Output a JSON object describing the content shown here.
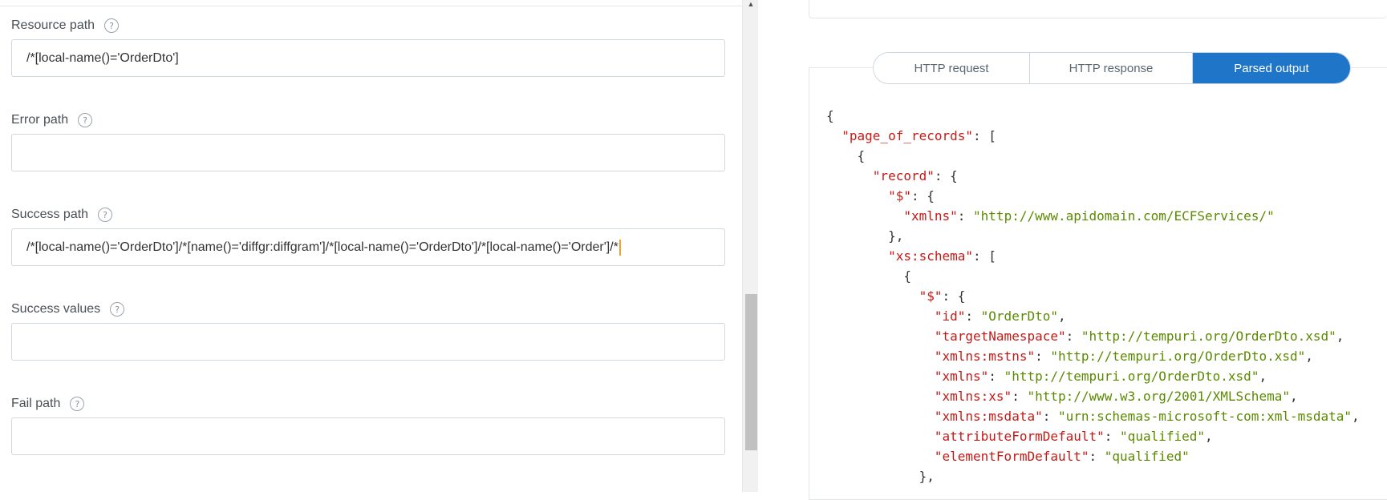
{
  "form": {
    "resource_path": {
      "label": "Resource path",
      "value": "/*[local-name()='OrderDto']"
    },
    "error_path": {
      "label": "Error path",
      "value": ""
    },
    "success_path": {
      "label": "Success path",
      "value": "/*[local-name()='OrderDto']/*[name()='diffgr:diffgram']/*[local-name()='OrderDto']/*[local-name()='Order']/*"
    },
    "success_values": {
      "label": "Success values",
      "value": ""
    },
    "fail_path": {
      "label": "Fail path",
      "value": ""
    },
    "help_glyph": "?"
  },
  "scrollbar": {
    "up_arrow": "▲"
  },
  "output": {
    "tabs": [
      {
        "label": "HTTP request",
        "active": false
      },
      {
        "label": "HTTP response",
        "active": false
      },
      {
        "label": "Parsed output",
        "active": true
      }
    ],
    "json_lines": [
      [
        [
          "p",
          "{"
        ]
      ],
      [
        [
          "p",
          "  "
        ],
        [
          "k",
          "\"page_of_records\""
        ],
        [
          "p",
          ": ["
        ]
      ],
      [
        [
          "p",
          "    {"
        ]
      ],
      [
        [
          "p",
          "      "
        ],
        [
          "k",
          "\"record\""
        ],
        [
          "p",
          ": {"
        ]
      ],
      [
        [
          "p",
          "        "
        ],
        [
          "k",
          "\"$\""
        ],
        [
          "p",
          ": {"
        ]
      ],
      [
        [
          "p",
          "          "
        ],
        [
          "k",
          "\"xmlns\""
        ],
        [
          "p",
          ": "
        ],
        [
          "s",
          "\"http://www.apidomain.com/ECFServices/\""
        ]
      ],
      [
        [
          "p",
          "        },"
        ]
      ],
      [
        [
          "p",
          "        "
        ],
        [
          "k",
          "\"xs:schema\""
        ],
        [
          "p",
          ": ["
        ]
      ],
      [
        [
          "p",
          "          {"
        ]
      ],
      [
        [
          "p",
          "            "
        ],
        [
          "k",
          "\"$\""
        ],
        [
          "p",
          ": {"
        ]
      ],
      [
        [
          "p",
          "              "
        ],
        [
          "k",
          "\"id\""
        ],
        [
          "p",
          ": "
        ],
        [
          "s",
          "\"OrderDto\""
        ],
        [
          "p",
          ","
        ]
      ],
      [
        [
          "p",
          "              "
        ],
        [
          "k",
          "\"targetNamespace\""
        ],
        [
          "p",
          ": "
        ],
        [
          "s",
          "\"http://tempuri.org/OrderDto.xsd\""
        ],
        [
          "p",
          ","
        ]
      ],
      [
        [
          "p",
          "              "
        ],
        [
          "k",
          "\"xmlns:mstns\""
        ],
        [
          "p",
          ": "
        ],
        [
          "s",
          "\"http://tempuri.org/OrderDto.xsd\""
        ],
        [
          "p",
          ","
        ]
      ],
      [
        [
          "p",
          "              "
        ],
        [
          "k",
          "\"xmlns\""
        ],
        [
          "p",
          ": "
        ],
        [
          "s",
          "\"http://tempuri.org/OrderDto.xsd\""
        ],
        [
          "p",
          ","
        ]
      ],
      [
        [
          "p",
          "              "
        ],
        [
          "k",
          "\"xmlns:xs\""
        ],
        [
          "p",
          ": "
        ],
        [
          "s",
          "\"http://www.w3.org/2001/XMLSchema\""
        ],
        [
          "p",
          ","
        ]
      ],
      [
        [
          "p",
          "              "
        ],
        [
          "k",
          "\"xmlns:msdata\""
        ],
        [
          "p",
          ": "
        ],
        [
          "s",
          "\"urn:schemas-microsoft-com:xml-msdata\""
        ],
        [
          "p",
          ","
        ]
      ],
      [
        [
          "p",
          "              "
        ],
        [
          "k",
          "\"attributeFormDefault\""
        ],
        [
          "p",
          ": "
        ],
        [
          "s",
          "\"qualified\""
        ],
        [
          "p",
          ","
        ]
      ],
      [
        [
          "p",
          "              "
        ],
        [
          "k",
          "\"elementFormDefault\""
        ],
        [
          "p",
          ": "
        ],
        [
          "s",
          "\"qualified\""
        ]
      ],
      [
        [
          "p",
          "            },"
        ]
      ]
    ]
  },
  "colors": {
    "accent": "#1f76c9",
    "json_key": "#c41a16",
    "json_string": "#5b8a00",
    "border": "#cfd8de"
  }
}
